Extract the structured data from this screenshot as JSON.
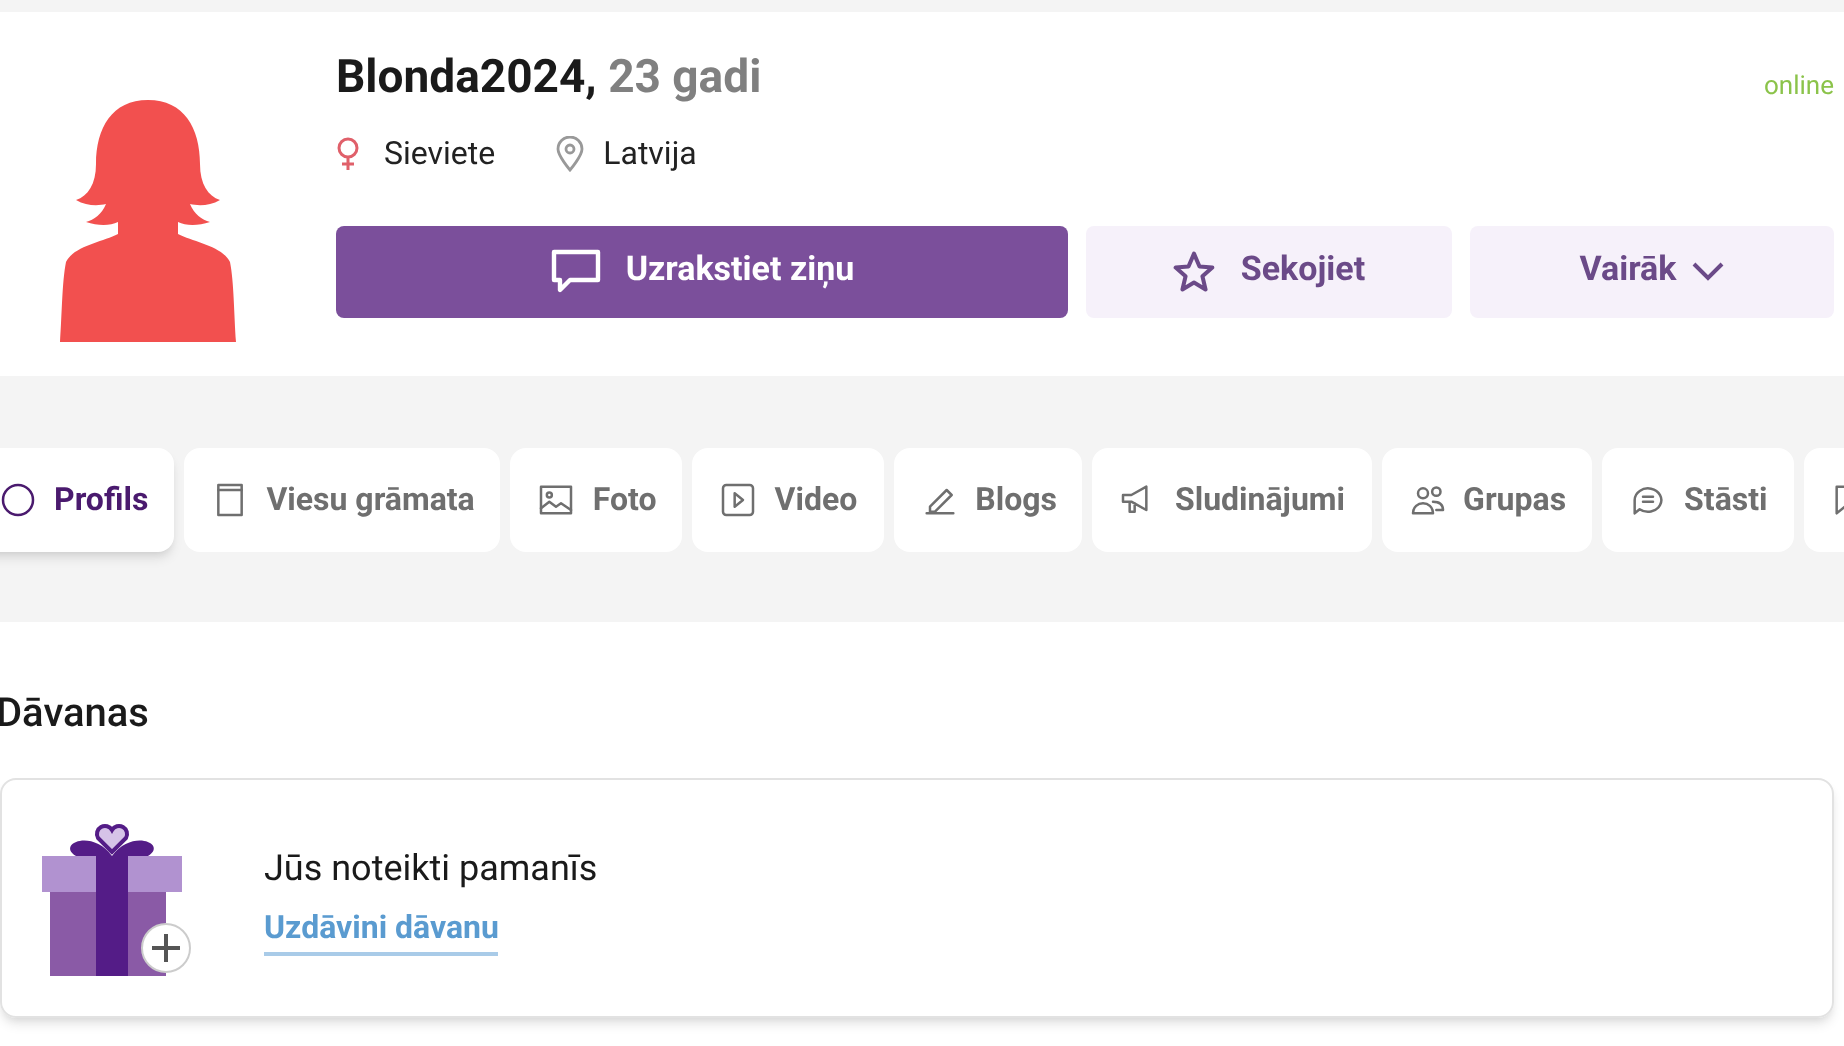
{
  "profile": {
    "username": "Blonda2024,",
    "age": "23 gadi",
    "status": "online",
    "gender": "Sieviete",
    "location": "Latvija"
  },
  "actions": [
    {
      "kind": "primary",
      "label": "Uzrakstiet ziņu"
    },
    {
      "kind": "follow",
      "label": "Sekojiet"
    },
    {
      "kind": "more",
      "label": "Vairāk"
    }
  ],
  "tabs": [
    {
      "label": "Profils",
      "selected": true
    },
    {
      "label": "Viesu grāmata",
      "selected": false
    },
    {
      "label": "Foto",
      "selected": false
    },
    {
      "label": "Video",
      "selected": false
    },
    {
      "label": "Blogs",
      "selected": false
    },
    {
      "label": "Sludinājumi",
      "selected": false
    },
    {
      "label": "Grupas",
      "selected": false
    },
    {
      "label": "Stāsti",
      "selected": false
    },
    {
      "selected": false
    }
  ],
  "gifts": {
    "heading": "Dāvanas",
    "message": "Jūs noteikti pamanīs",
    "link": "Uzdāvini dāvanu"
  }
}
